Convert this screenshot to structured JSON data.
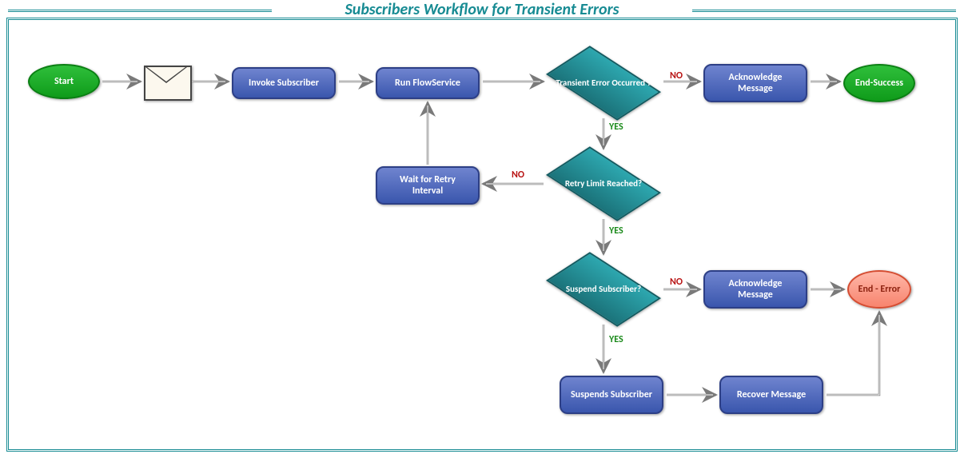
{
  "title": "Subscribers Workflow for Transient Errors",
  "nodes": {
    "start": "Start",
    "invoke": "Invoke Subscriber",
    "run": "Run FlowService",
    "d1": "Transient Error Occurred ?",
    "ack1": "Acknowledge Message",
    "endSuccess": "End-Success",
    "d2": "Retry Limit Reached?",
    "wait": "Wait  for Retry Interval",
    "d3": "Suspend Subscriber?",
    "ack2": "Acknowledge Message",
    "endError": "End - Error",
    "suspend": "Suspends Subscriber",
    "recover": "Recover Message"
  },
  "labels": {
    "no": "NO",
    "yes": "YES"
  }
}
